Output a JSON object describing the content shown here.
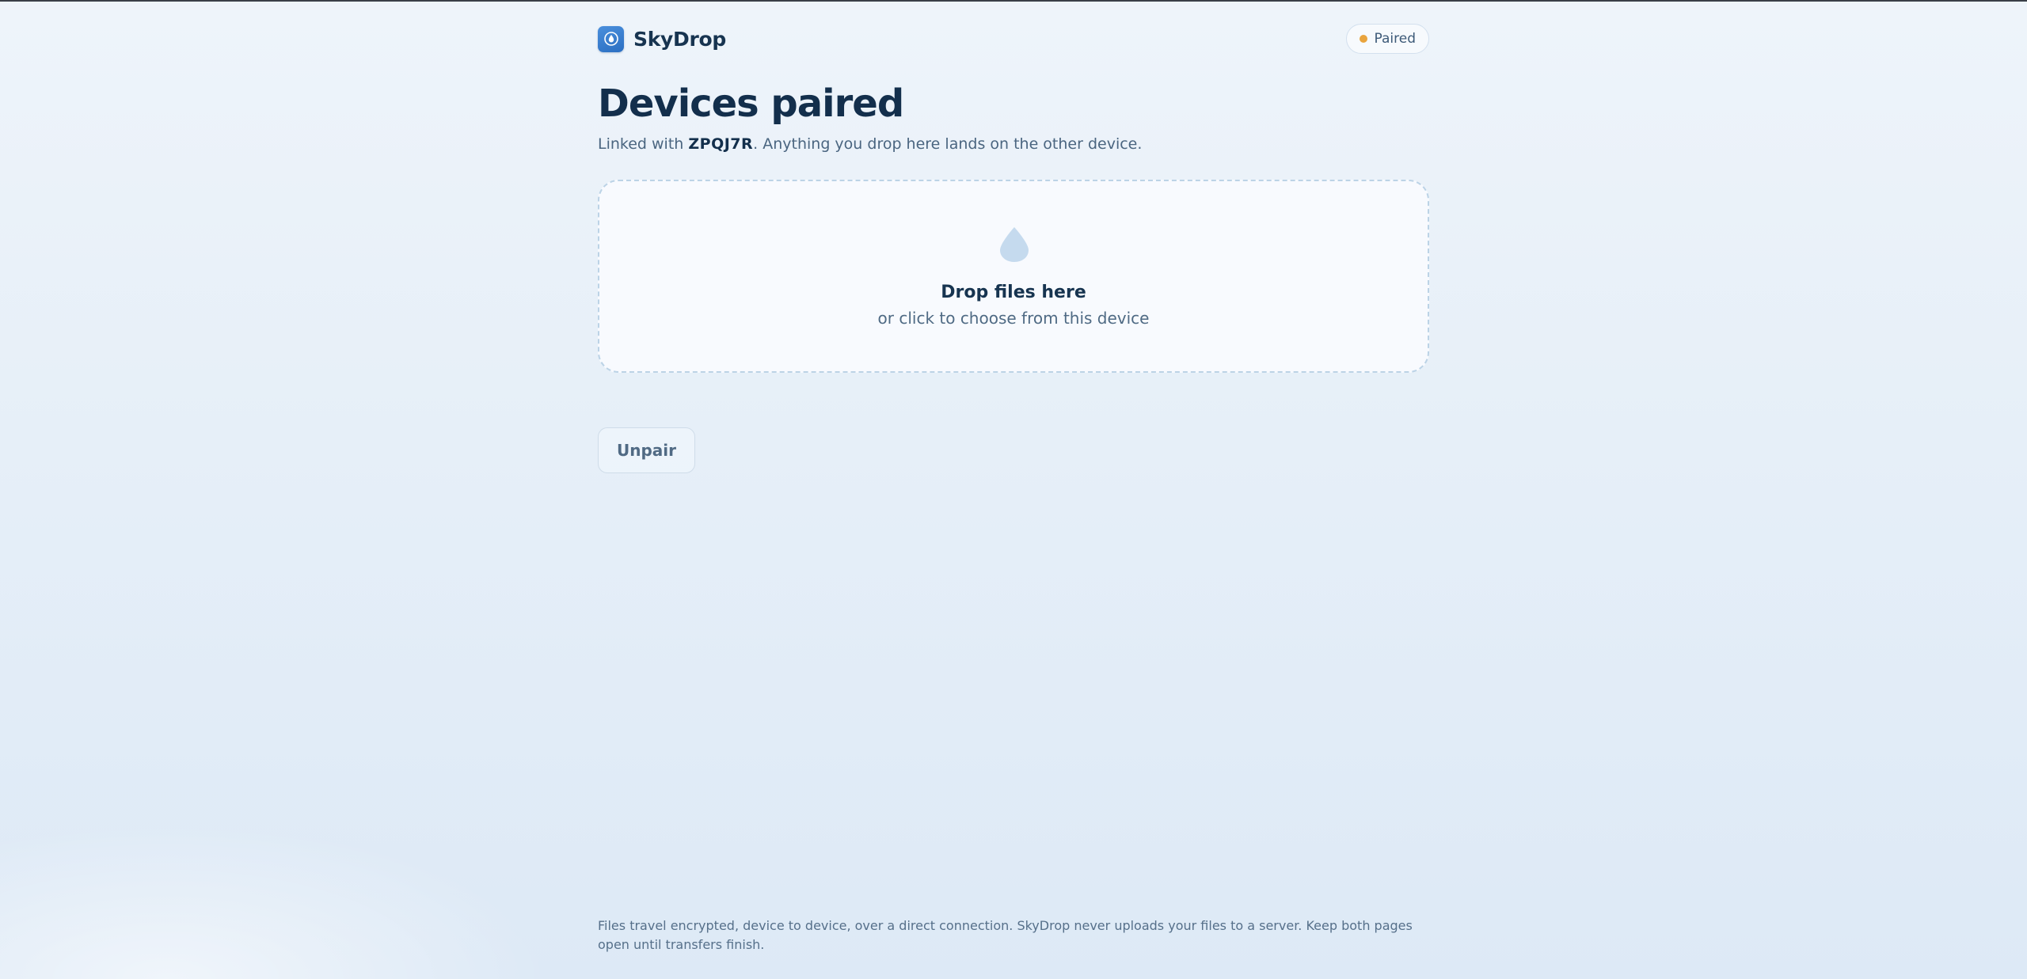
{
  "app": {
    "name": "SkyDrop",
    "logo_icon": "drop-icon"
  },
  "status": {
    "label": "Paired",
    "color": "#e9a43d"
  },
  "page": {
    "title": "Devices paired",
    "subtitle_prefix": "Linked with ",
    "pair_code": "ZPQJ7R",
    "subtitle_suffix": ". Anything you drop here lands on the other device."
  },
  "dropzone": {
    "icon": "water-drop-icon",
    "title": "Drop files here",
    "subtitle": "or click to choose from this device"
  },
  "actions": {
    "unpair_label": "Unpair"
  },
  "footer": {
    "text": "Files travel encrypted, device to device, over a direct connection. SkyDrop never uploads your files to a server. Keep both pages open until transfers finish."
  },
  "colors": {
    "accent": "#2f74c8",
    "heading": "#132f4c",
    "muted": "#4a6580"
  }
}
